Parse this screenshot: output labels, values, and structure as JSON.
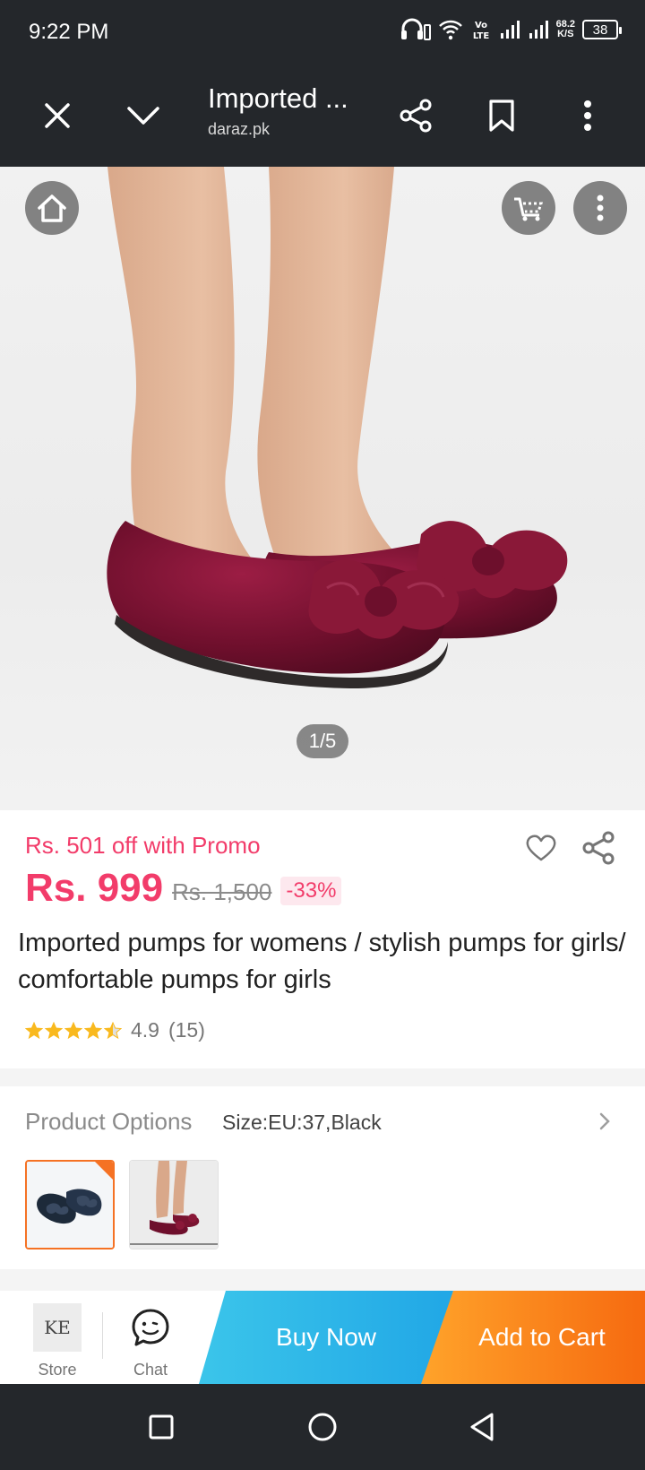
{
  "status_bar": {
    "time": "9:22 PM",
    "net_speed_value": "68.2",
    "net_speed_unit": "K/S",
    "battery": "38",
    "icons": [
      "headphones-icon",
      "wifi-icon",
      "volte-icon",
      "signal-icon",
      "signal-icon",
      "battery-icon"
    ]
  },
  "browser": {
    "title": "Imported ...",
    "url": "daraz.pk",
    "icons": [
      "close-icon",
      "chevron-down-icon",
      "share-icon",
      "bookmark-icon",
      "more-vertical-icon"
    ]
  },
  "gallery": {
    "pager": "1/5",
    "icons": [
      "home-icon",
      "cart-icon",
      "more-vertical-icon"
    ]
  },
  "product": {
    "promo": "Rs. 501 off with Promo",
    "price": "Rs. 999",
    "old_price": "Rs. 1,500",
    "discount": "-33%",
    "title": "Imported pumps for womens / stylish pumps for girls/ comfortable pumps for girls",
    "rating": "4.9",
    "review_count": "(15)",
    "stars": 4.5,
    "colors": {
      "accent": "#f23c6a",
      "star": "#f9b91e"
    }
  },
  "options": {
    "label": "Product Options",
    "value": "Size:EU:37,Black"
  },
  "actions": {
    "store_logo": "KE",
    "store_label": "Store",
    "chat_label": "Chat",
    "buy_now": "Buy Now",
    "add_to_cart": "Add to Cart",
    "colors": {
      "buy_now": "#21a7e6",
      "add_to_cart": "#f66a10"
    }
  },
  "nav": {
    "icons": [
      "recents-icon",
      "home-circle-icon",
      "back-triangle-icon"
    ]
  }
}
